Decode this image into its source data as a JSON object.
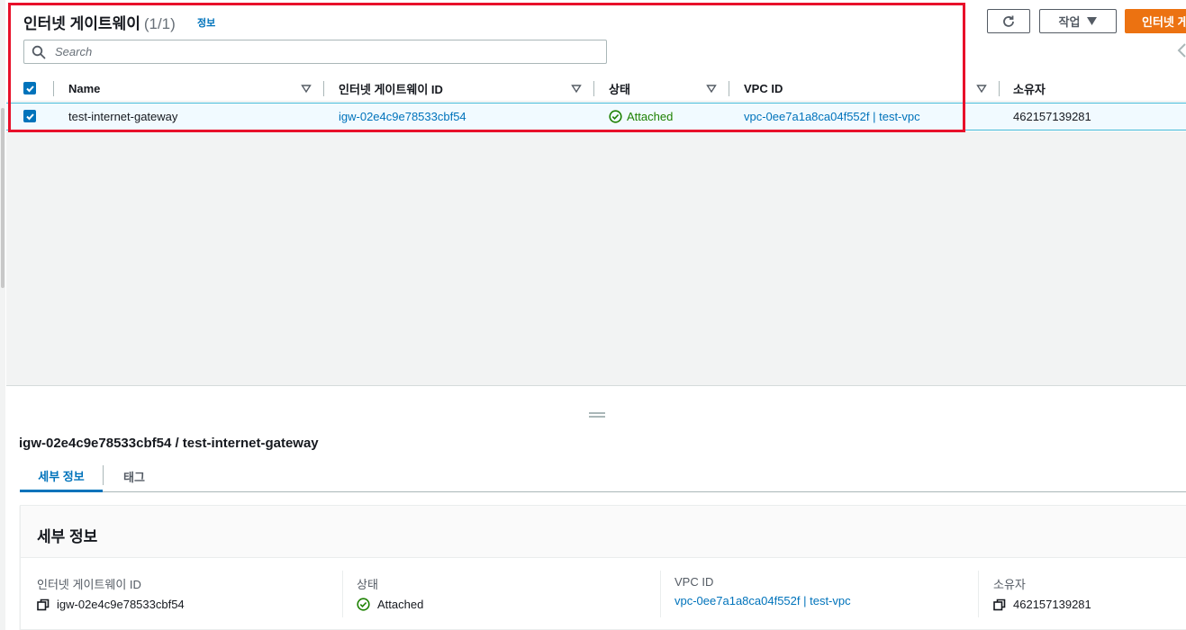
{
  "header": {
    "title": "인터넷 게이트웨이",
    "count": "(1/1)",
    "info_link": "정보",
    "actions_label": "작업",
    "create_label": "인터넷 게"
  },
  "search": {
    "placeholder": "Search"
  },
  "table": {
    "columns": [
      "Name",
      "인터넷 게이트웨이 ID",
      "상태",
      "VPC ID",
      "소유자"
    ],
    "rows": [
      {
        "name": "test-internet-gateway",
        "igw_id": "igw-02e4c9e78533cbf54",
        "status": "Attached",
        "vpc_id": "vpc-0ee7a1a8ca04f552f | test-vpc",
        "owner": "462157139281"
      }
    ]
  },
  "details": {
    "title": "igw-02e4c9e78533cbf54 / test-internet-gateway",
    "tabs": [
      "세부 정보",
      "태그"
    ],
    "card_title": "세부 정보",
    "fields": [
      {
        "label": "인터넷 게이트웨이 ID",
        "value": "igw-02e4c9e78533cbf54"
      },
      {
        "label": "상태",
        "value": "Attached"
      },
      {
        "label": "VPC ID",
        "value": "vpc-0ee7a1a8ca04f552f | test-vpc"
      },
      {
        "label": "소유자",
        "value": "462157139281"
      }
    ]
  },
  "colors": {
    "link": "#0073bb",
    "success": "#1d8102",
    "primary_button": "#ec7211",
    "highlight": "#e8102a"
  }
}
